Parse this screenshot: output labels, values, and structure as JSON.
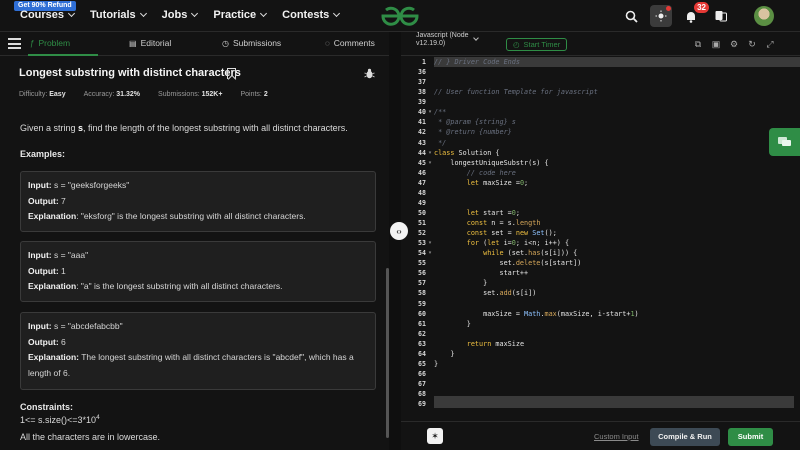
{
  "nav": {
    "refund_badge": "Get 90% Refund",
    "items": [
      {
        "label": "Courses"
      },
      {
        "label": "Tutorials"
      },
      {
        "label": "Jobs"
      },
      {
        "label": "Practice"
      },
      {
        "label": "Contests"
      }
    ],
    "notification_count": "32",
    "brand_color": "#2f8d46"
  },
  "tabs": {
    "problem": "Problem",
    "editorial": "Editorial",
    "submissions": "Submissions",
    "comments": "Comments"
  },
  "problem": {
    "title": "Longest substring with distinct characters",
    "meta": {
      "difficulty_label": "Difficulty:",
      "difficulty": "Easy",
      "accuracy_label": "Accuracy:",
      "accuracy": "31.32%",
      "submissions_label": "Submissions:",
      "submissions": "152K+",
      "points_label": "Points:",
      "points": "2"
    },
    "desc_pre": "Given a string ",
    "desc_var": "s",
    "desc_post": ", find the length of the longest substring with all distinct characters.",
    "examples_heading": "Examples:",
    "examples": [
      {
        "input_label": "Input:",
        "input": " s = \"geeksforgeeks\"",
        "output_label": "Output:",
        "output": " 7",
        "expl_label": "Explanation",
        "expl": ": \"eksforg\" is the longest substring with all distinct characters."
      },
      {
        "input_label": "Input:",
        "input": " s = \"aaa\"",
        "output_label": "Output:",
        "output": " 1",
        "expl_label": "Explanation",
        "expl": ": \"a\" is the longest substring with all distinct characters."
      },
      {
        "input_label": "Input:",
        "input": " s = \"abcdefabcbb\"",
        "output_label": "Output:",
        "output": " 6",
        "expl_label": "Explanation:",
        "expl": " The longest substring with all distinct characters is \"abcdef\", which has a length of 6."
      }
    ],
    "constraints_heading": "Constraints:",
    "constraint1_base": "1<= s.size()<=3*10",
    "constraint1_exp": "4",
    "constraint2": "All the characters are in lowercase."
  },
  "editor": {
    "language": "Javascript (Node v12.19.0)",
    "timer_label": "Start Timer",
    "line_numbers": [
      "1",
      "36",
      "37",
      "38",
      "39",
      "40",
      "41",
      "42",
      "43",
      "44",
      "45",
      "46",
      "47",
      "48",
      "49",
      "50",
      "51",
      "52",
      "53",
      "54",
      "55",
      "56",
      "57",
      "58",
      "59",
      "60",
      "61",
      "62",
      "63",
      "64",
      "65",
      "66",
      "67",
      "68",
      "69"
    ],
    "lines": [
      "// } Driver Code Ends",
      "",
      "",
      "// User function Template for javascript",
      "",
      "/**",
      " * @param {string} s",
      " * @return {number}",
      " */",
      "class Solution {",
      "    longestUniqueSubstr(s) {",
      "        // code here",
      "        let maxSize =0;",
      "",
      "",
      "        let start =0;",
      "        const n = s.length",
      "        const set = new Set();",
      "        for (let i=0; i<n; i++) {",
      "            while (set.has(s[i])) {",
      "                set.delete(s[start])",
      "                start++",
      "            }",
      "            set.add(s[i])",
      "",
      "            maxSize = Math.max(maxSize, i-start+1)",
      "        }",
      "",
      "        return maxSize",
      "    }",
      "}",
      "",
      "",
      "",
      ""
    ]
  },
  "footer": {
    "custom_input": "Custom Input",
    "compile_run": "Compile & Run",
    "submit": "Submit"
  }
}
